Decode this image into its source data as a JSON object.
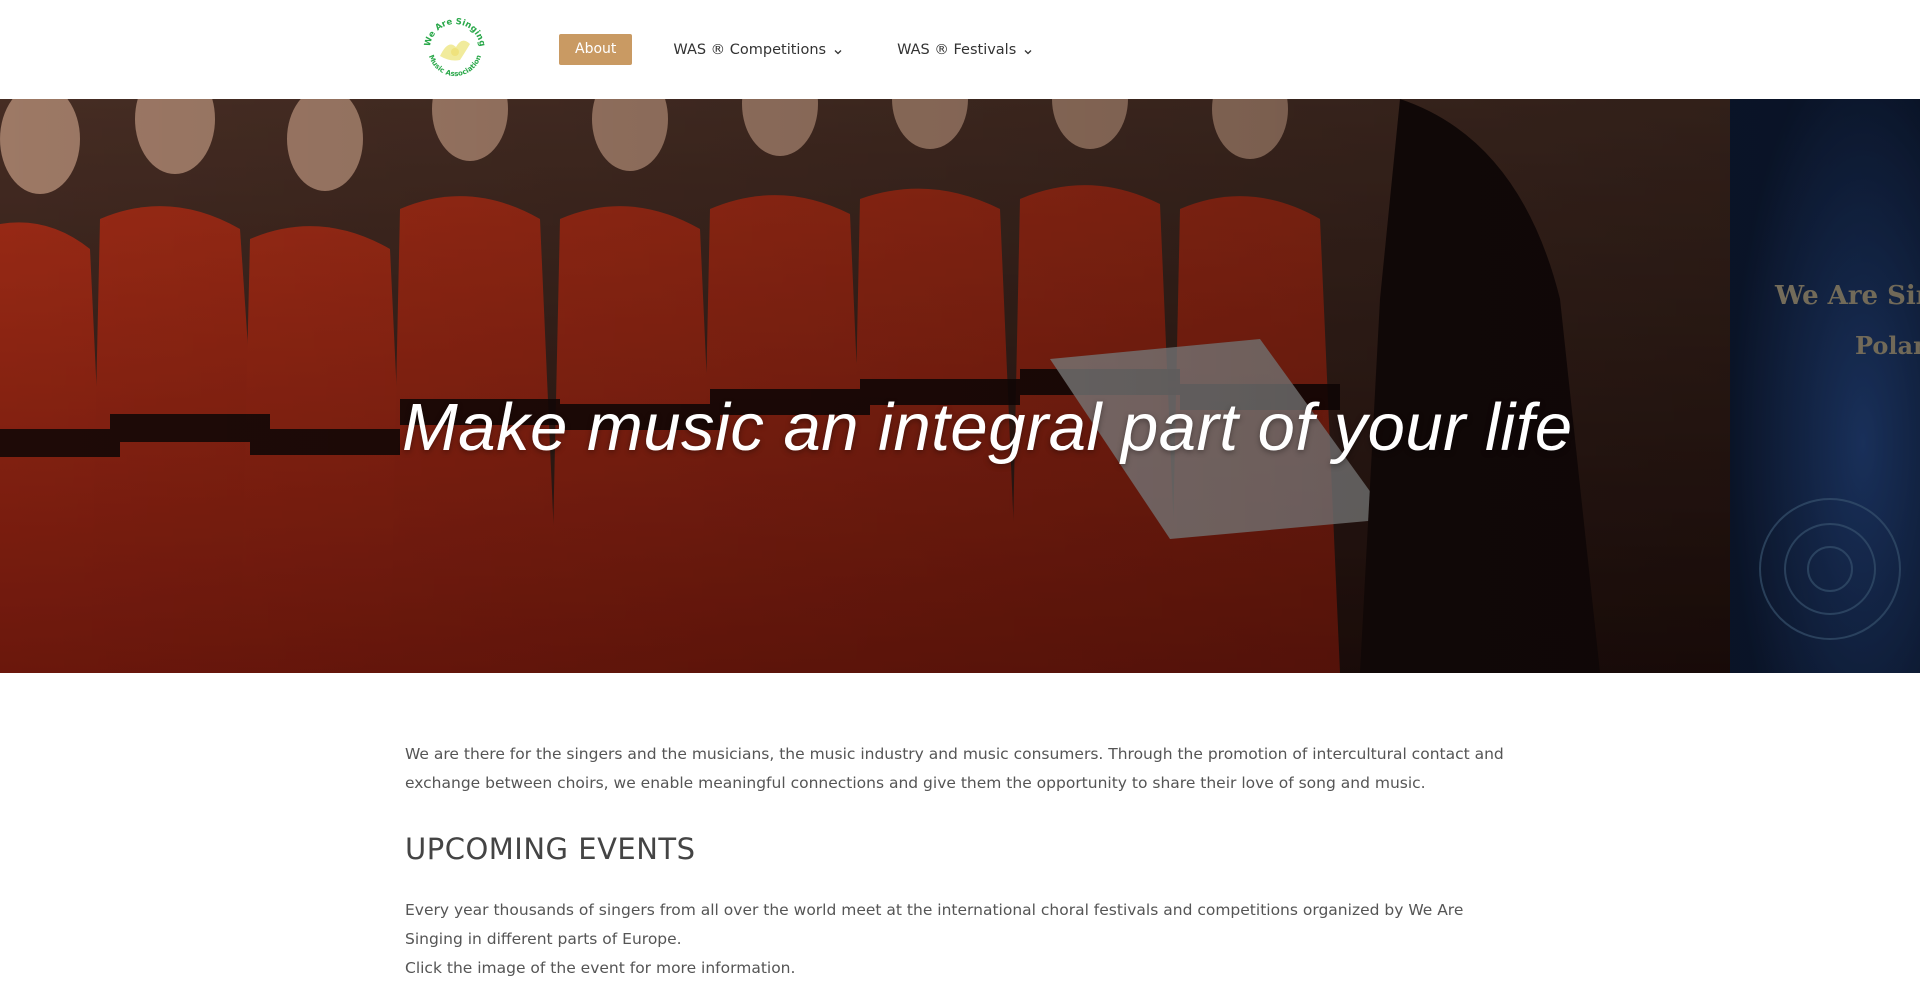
{
  "logo": {
    "top_text": "We Are Singing",
    "bottom_text": "Music Association",
    "accent": "#2aa84a"
  },
  "nav": {
    "about_label": "About",
    "competitions_label": "WAS ® Competitions",
    "festivals_label": "WAS ® Festivals",
    "accent": "#c99a63"
  },
  "hero": {
    "title": "Make music an integral part of your life",
    "banner_text_1": "We Are Singing",
    "banner_text_2": "Poland"
  },
  "main": {
    "intro": "We are there for the singers and the musicians, the music industry and music consumers. Through the promotion of intercultural contact and exchange between choirs, we enable meaningful connections and give them the opportunity to share their love of song and music.",
    "events_heading": "UPCOMING EVENTS",
    "events_text": "Every year thousands of singers from all over the world meet at the international choral festivals and competitions organized by We Are Singing in different parts of Europe.",
    "events_hint": "Click the image of the event for more information."
  }
}
